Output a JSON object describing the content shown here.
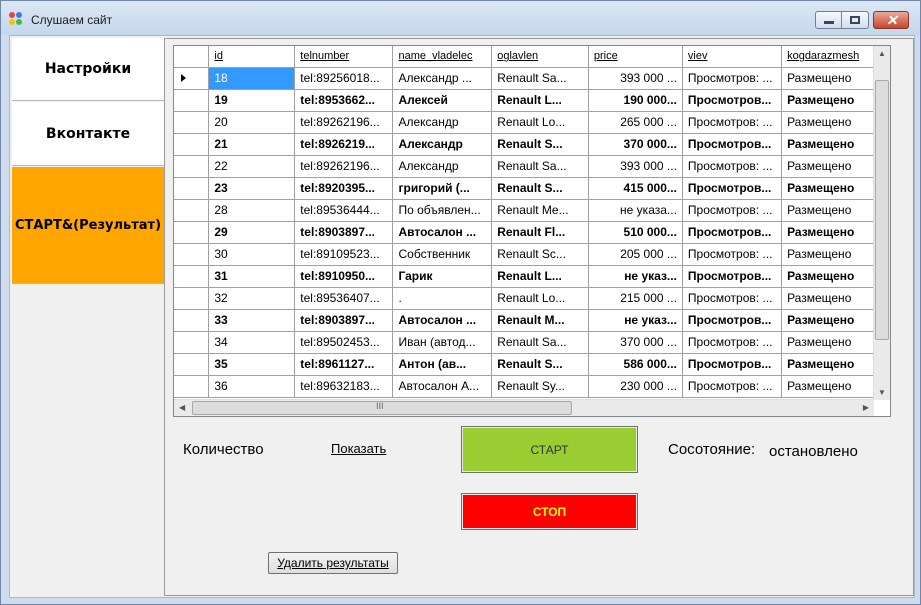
{
  "window": {
    "title": "Слушаем сайт",
    "icons": {
      "app": "app-icon",
      "minimize": "minimize-icon",
      "maximize": "maximize-icon",
      "close": "close-icon"
    }
  },
  "tabs": [
    {
      "label": "Настройки"
    },
    {
      "label": "Вконтакте"
    },
    {
      "label": "СТАРТ&(Результат)",
      "active": true
    }
  ],
  "grid": {
    "columns": [
      "id",
      "telnumber",
      "name_vladelec",
      "oglavlen",
      "price",
      "viev",
      "kogdarazmesh"
    ],
    "rows": [
      {
        "id": "18",
        "tel": "tel:89256018...",
        "name": "Александр    ...",
        "ogl": "Renault Sa...",
        "price": "393 000 ...",
        "viev": "Просмотров: ...",
        "kogda": "Размещено",
        "bold": false
      },
      {
        "id": "19",
        "tel": "tel:8953662...",
        "name": "Алексей",
        "ogl": "Renault L...",
        "price": "190 000...",
        "viev": "Просмотров...",
        "kogda": "Размещено",
        "bold": true
      },
      {
        "id": "20",
        "tel": "tel:89262196...",
        "name": "Александр",
        "ogl": "Renault Lo...",
        "price": "265 000 ...",
        "viev": "Просмотров: ...",
        "kogda": "Размещено",
        "bold": false
      },
      {
        "id": "21",
        "tel": "tel:8926219...",
        "name": "Александр",
        "ogl": "Renault S...",
        "price": "370 000...",
        "viev": "Просмотров...",
        "kogda": "Размещено",
        "bold": true
      },
      {
        "id": "22",
        "tel": "tel:89262196...",
        "name": "Александр",
        "ogl": "Renault Sa...",
        "price": "393 000 ...",
        "viev": "Просмотров: ...",
        "kogda": "Размещено",
        "bold": false
      },
      {
        "id": "23",
        "tel": "tel:8920395...",
        "name": "григорий    (...",
        "ogl": "Renault S...",
        "price": "415 000...",
        "viev": "Просмотров...",
        "kogda": "Размещено",
        "bold": true
      },
      {
        "id": "28",
        "tel": "tel:89536444...",
        "name": "По объявлен...",
        "ogl": "Renault Me...",
        "price": "не указа...",
        "viev": "Просмотров: ...",
        "kogda": "Размещено",
        "bold": false
      },
      {
        "id": "29",
        "tel": "tel:8903897...",
        "name": "Автосалон   ...",
        "ogl": "Renault Fl...",
        "price": "510 000...",
        "viev": "Просмотров...",
        "kogda": "Размещено",
        "bold": true
      },
      {
        "id": "30",
        "tel": "tel:89109523...",
        "name": "Собственник",
        "ogl": "Renault Sc...",
        "price": "205 000 ...",
        "viev": "Просмотров: ...",
        "kogda": "Размещено",
        "bold": false
      },
      {
        "id": "31",
        "tel": "tel:8910950...",
        "name": "Гарик",
        "ogl": "Renault L...",
        "price": "не указ...",
        "viev": "Просмотров...",
        "kogda": "Размещено",
        "bold": true
      },
      {
        "id": "32",
        "tel": "tel:89536407...",
        "name": ".",
        "ogl": "Renault Lo...",
        "price": "215 000 ...",
        "viev": "Просмотров: ...",
        "kogda": "Размещено",
        "bold": false
      },
      {
        "id": "33",
        "tel": "tel:8903897...",
        "name": "Автосалон   ...",
        "ogl": "Renault M...",
        "price": "не указ...",
        "viev": "Просмотров...",
        "kogda": "Размещено",
        "bold": true
      },
      {
        "id": "34",
        "tel": "tel:89502453...",
        "name": "Иван    (автод...",
        "ogl": "Renault Sa...",
        "price": "370 000 ...",
        "viev": "Просмотров: ...",
        "kogda": "Размещено",
        "bold": false
      },
      {
        "id": "35",
        "tel": "tel:8961127...",
        "name": "Антон    (ав...",
        "ogl": "Renault S...",
        "price": "586 000...",
        "viev": "Просмотров...",
        "kogda": "Размещено",
        "bold": true
      },
      {
        "id": "36",
        "tel": "tel:89632183...",
        "name": "Автосалон А...",
        "ogl": "Renault Sy...",
        "price": "230 000 ...",
        "viev": "Просмотров: ...",
        "kogda": "Размещено",
        "bold": false
      }
    ],
    "selected_row": 0,
    "row_marker_icon": "current-row-arrow-icon",
    "scroll_icons": [
      "scroll-up-icon",
      "scroll-down-icon",
      "scroll-left-icon",
      "scroll-right-icon"
    ],
    "hscroll_grip": "III"
  },
  "controls": {
    "count_label": "Количество",
    "show_link": "Показать",
    "start_button": "СТАРТ",
    "stop_button": "СТОП",
    "state_label": "Сосотояние:",
    "state_value": "остановлено",
    "delete_button": "Удалить результаты"
  },
  "colors": {
    "active_tab": "#ffa500",
    "start_button": "#9acd32",
    "stop_button": "#ff0000",
    "stop_text": "#ffff00",
    "selection": "#3399ff"
  }
}
